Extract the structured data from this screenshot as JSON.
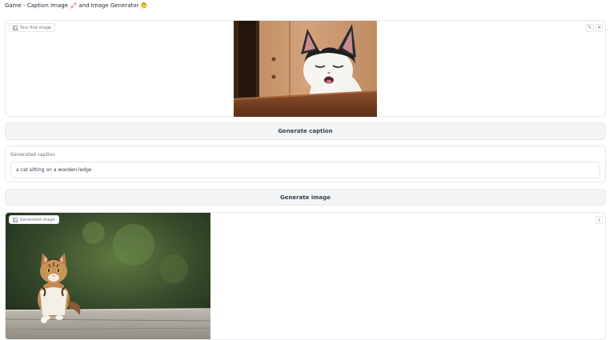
{
  "app": {
    "title": "Game - Caption Image",
    "title_emoji_1": "🖍",
    "title_middle": "and Image Generator",
    "title_emoji_2": "🤔"
  },
  "input_image": {
    "label": "Your first image",
    "label_icon": "image-icon",
    "edit_icon": "pencil-icon",
    "clear_icon": "close-icon"
  },
  "caption_button": {
    "label": "Generate caption"
  },
  "caption_field": {
    "label": "Generated caption",
    "value": "a cat sitting on a wooden ledge"
  },
  "image_button": {
    "label": "Generate image"
  },
  "output_image": {
    "label": "Generated image",
    "label_icon": "image-icon",
    "download_icon": "download-icon"
  },
  "colors": {
    "border": "#e5e7eb",
    "button_bg": "#f3f4f6",
    "text": "#374151",
    "muted": "#6b7280"
  }
}
